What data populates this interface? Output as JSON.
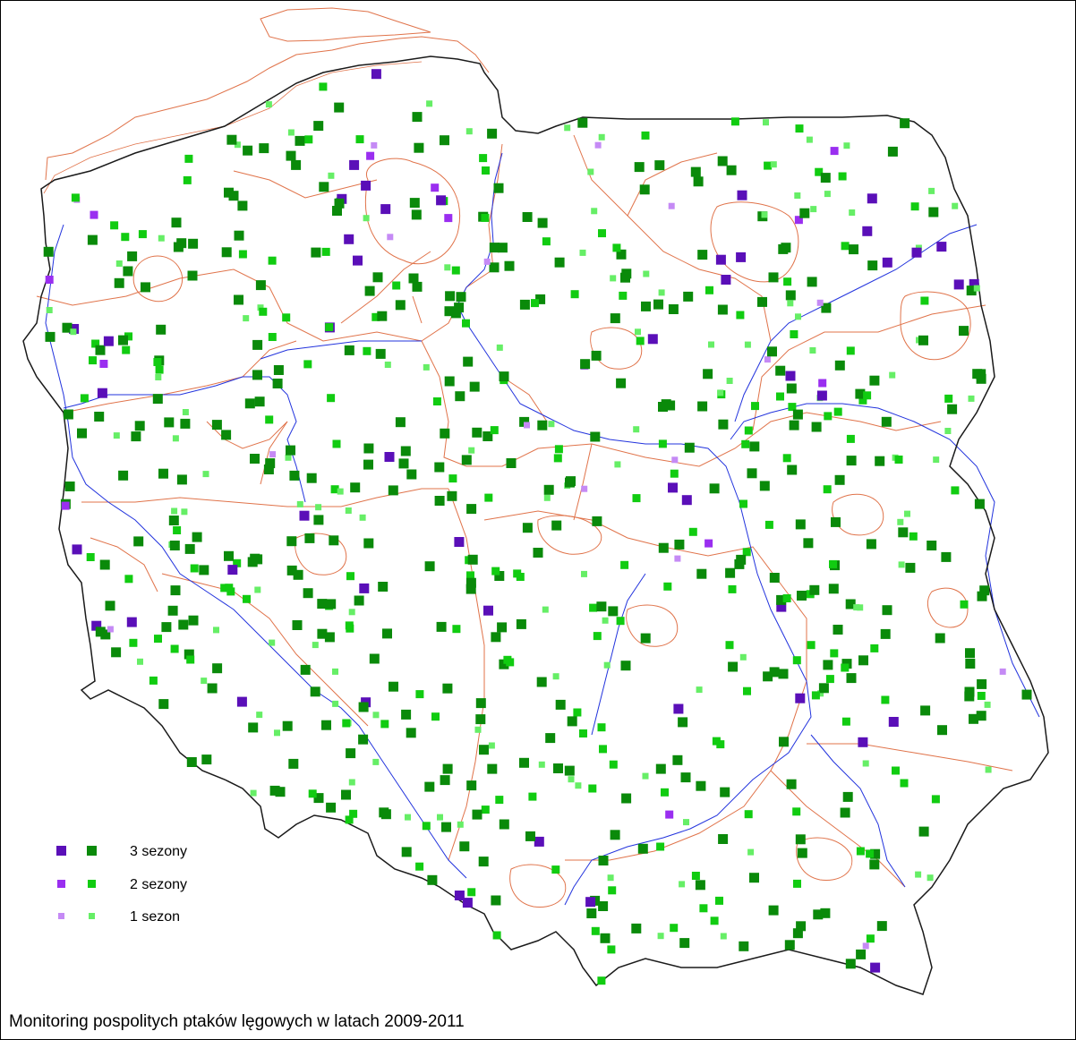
{
  "title": "Monitoring pospolitych ptaków lęgowych w latach 2009-2011",
  "legend": {
    "items": [
      {
        "label": "3 sezony",
        "seasons": 3
      },
      {
        "label": "2 sezony",
        "seasons": 2
      },
      {
        "label": "1 sezon",
        "seasons": 1
      }
    ]
  },
  "colors": {
    "country_border": "#1a1a1a",
    "regional_borders": "#e0734a",
    "rivers": "#2233dd",
    "green_3": "#0a8a0a",
    "green_2": "#11cc11",
    "green_1": "#66ee66",
    "purple_3": "#5a0fb8",
    "purple_2": "#9a2ef0",
    "purple_1": "#c58af5"
  }
}
